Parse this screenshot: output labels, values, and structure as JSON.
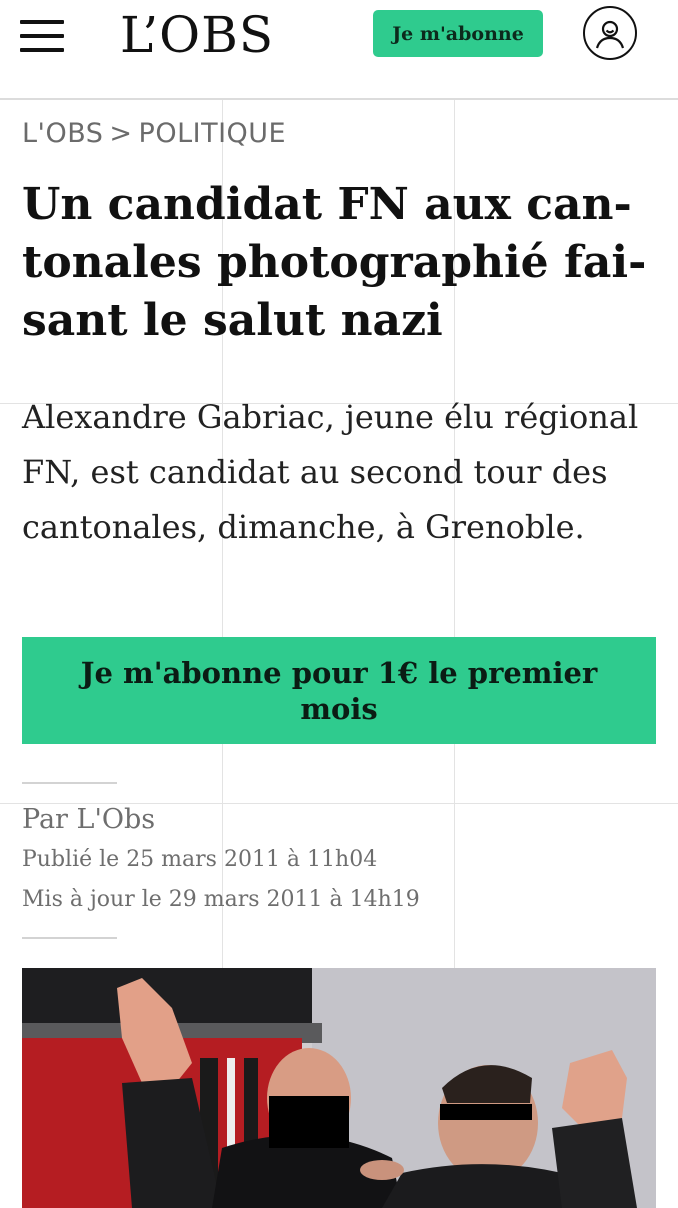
{
  "header": {
    "logo": "L’OBS",
    "subscribe_label": "Je m'abonne",
    "icons": {
      "menu": "hamburger-menu-icon",
      "account": "user-account-icon"
    }
  },
  "breadcrumb": {
    "home": "L'OBS",
    "separator": ">",
    "section": "POLITIQUE"
  },
  "article": {
    "title": "Un candidat FN aux can­tonales photographié fai­sant le salut nazi",
    "lead": "Alexandre Gabriac, jeune élu régio­nal FN, est candidat au second tour des cantonales, dimanche, à Grenoble.",
    "cta_label": "Je m'abonne pour 1€ le premier mois",
    "author": "Par L'Obs",
    "published": "Publié le 25 mars 2011 à 11h04",
    "updated": "Mis à jour le 29 mars 2011 à 14h19"
  },
  "colors": {
    "accent_green": "#2fcb8e",
    "text_dark": "#111111",
    "text_muted": "#6e6e6e"
  }
}
